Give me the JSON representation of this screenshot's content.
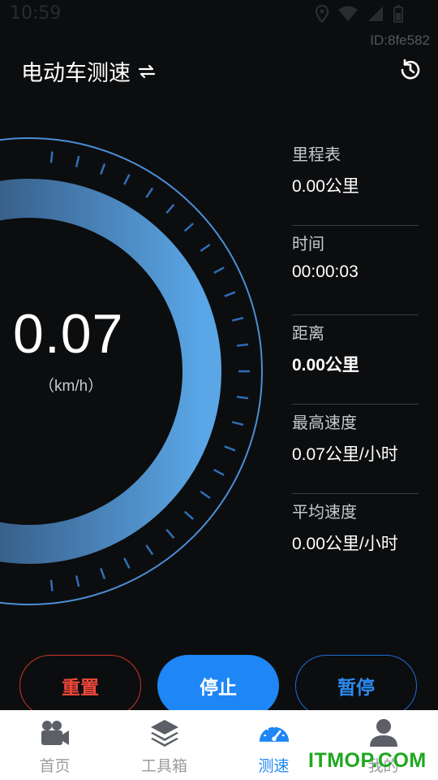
{
  "status": {
    "time": "10:59",
    "device_id": "ID:8fe582"
  },
  "header": {
    "title": "电动车测速",
    "swap_icon": "swap-arrows-icon",
    "history_icon": "history-clock-icon"
  },
  "gauge": {
    "speed_value": "0.07",
    "unit": "（km/h）"
  },
  "stats": [
    {
      "label": "里程表",
      "value": "0.00公里"
    },
    {
      "label": "时间",
      "value": "00:00:03"
    },
    {
      "label": "距离",
      "value": "0.00公里"
    },
    {
      "label": "最高速度",
      "value": "0.07公里/小时"
    },
    {
      "label": "平均速度",
      "value": "0.00公里/小时"
    }
  ],
  "buttons": {
    "reset": "重置",
    "stop": "停止",
    "pause": "暂停"
  },
  "tabs": [
    {
      "label": "首页",
      "icon": "video-camera-icon",
      "active": false
    },
    {
      "label": "工具箱",
      "icon": "layers-icon",
      "active": false
    },
    {
      "label": "测速",
      "icon": "speedometer-icon",
      "active": true
    },
    {
      "label": "我的",
      "icon": "user-icon",
      "active": false
    }
  ],
  "watermark": "ITMOP.COM",
  "colors": {
    "background": "#0c0d0f",
    "accent": "#1e86f5",
    "reset": "#f0483a",
    "ring": "#3f8fd8"
  }
}
